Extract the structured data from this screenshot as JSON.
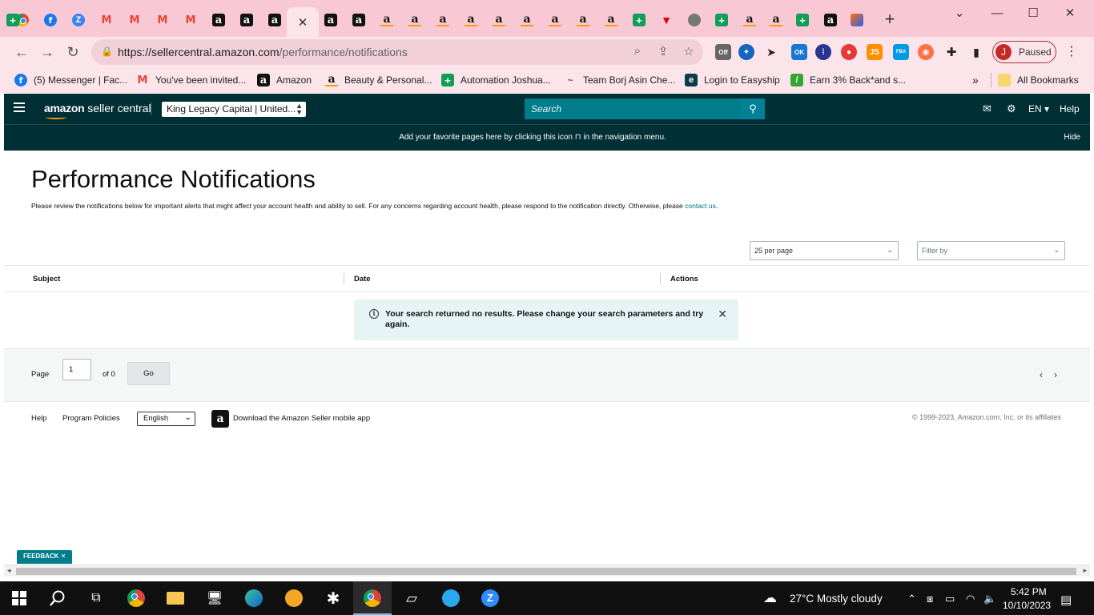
{
  "browser": {
    "tabs": [
      {
        "icon": "chrome-icon",
        "glyph": ""
      },
      {
        "icon": "facebook-icon",
        "glyph": "f"
      },
      {
        "icon": "zoho-icon",
        "glyph": "Z"
      },
      {
        "icon": "gmail-icon",
        "glyph": "M"
      },
      {
        "icon": "gmail-icon",
        "glyph": "M"
      },
      {
        "icon": "gmail-icon",
        "glyph": "M"
      },
      {
        "icon": "gmail-icon",
        "glyph": "M"
      },
      {
        "icon": "amazon-a-icon",
        "glyph": "a"
      },
      {
        "icon": "amazon-a-icon",
        "glyph": "a"
      },
      {
        "icon": "amazon-a-icon",
        "glyph": "a"
      },
      {
        "icon": "active-tab-close-icon",
        "glyph": "✕"
      },
      {
        "icon": "amazon-a-icon",
        "glyph": "a"
      },
      {
        "icon": "amazon-a-icon",
        "glyph": "a"
      },
      {
        "icon": "amazon-smile-icon",
        "glyph": "a"
      },
      {
        "icon": "amazon-smile-icon",
        "glyph": "a"
      },
      {
        "icon": "amazon-smile-icon",
        "glyph": "a"
      },
      {
        "icon": "amazon-smile-icon",
        "glyph": "a"
      },
      {
        "icon": "amazon-smile-icon",
        "glyph": "a"
      },
      {
        "icon": "amazon-smile-icon",
        "glyph": "a"
      },
      {
        "icon": "amazon-smile-icon",
        "glyph": "a"
      },
      {
        "icon": "amazon-smile-icon",
        "glyph": "a"
      },
      {
        "icon": "amazon-smile-icon",
        "glyph": "a"
      },
      {
        "icon": "google-sheets-icon",
        "glyph": "+"
      },
      {
        "icon": "red-triangle-icon",
        "glyph": "▼"
      },
      {
        "icon": "globe-icon",
        "glyph": ""
      },
      {
        "icon": "google-sheets-icon",
        "glyph": "+"
      },
      {
        "icon": "amazon-smile-icon",
        "glyph": "a"
      },
      {
        "icon": "amazon-smile-icon",
        "glyph": "a"
      },
      {
        "icon": "google-sheets-icon",
        "glyph": "+"
      },
      {
        "icon": "amazon-a-icon",
        "glyph": "a"
      },
      {
        "icon": "multicolor-app-icon",
        "glyph": ""
      },
      {
        "icon": "google-sheets-icon",
        "glyph": "+"
      }
    ],
    "new_tab": "+",
    "window_controls": {
      "chevron": "⌄",
      "minimize": "—",
      "maximize": "☐",
      "close": "✕"
    },
    "url_host": "https://sellercentral.amazon.com",
    "url_path": "/performance/notifications",
    "profile_initial": "J",
    "profile_status": "Paused",
    "extensions": {
      "off": "Off",
      "ok": "OK",
      "js": "JS",
      "fba": "FBA"
    }
  },
  "bookmarks": [
    {
      "label": "(5) Messenger | Fac...",
      "icon": "facebook-icon",
      "glyph": "f"
    },
    {
      "label": "You've been invited...",
      "icon": "gmail-icon",
      "glyph": "M"
    },
    {
      "label": "Amazon",
      "icon": "amazon-a-icon",
      "glyph": "a"
    },
    {
      "label": "Beauty & Personal...",
      "icon": "amazon-smile-icon",
      "glyph": "a"
    },
    {
      "label": "Automation Joshua...",
      "icon": "google-sheets-icon",
      "glyph": "+"
    },
    {
      "label": "Team Borj Asin Che...",
      "icon": "team-logo-icon",
      "glyph": "~"
    },
    {
      "label": "Login to Easyship",
      "icon": "easyship-icon",
      "glyph": "e"
    },
    {
      "label": "Earn 3% Back*and s...",
      "icon": "cashback-icon",
      "glyph": "/"
    }
  ],
  "bookmarks_more": "»",
  "all_bookmarks": "All Bookmarks",
  "seller_central": {
    "logo_amazon": "amazon",
    "logo_rest": " seller central",
    "account_selector": "King Legacy Capital | United...",
    "search_placeholder": "Search",
    "language": "EN",
    "help": "Help",
    "favorites_message": "Add your favorite pages here by clicking this icon",
    "favorites_message_tail": "in the navigation menu.",
    "hide": "Hide"
  },
  "page": {
    "title": "Performance Notifications",
    "intro": "Please review the notifications below for important alerts that might affect your account health and ability to sell. For any concerns regarding account health, please respond to the notification directly. Otherwise, please ",
    "contact_link": "contact us",
    "intro_end": ".",
    "per_page": "25 per page",
    "filter_placeholder": "Filter by",
    "columns": [
      "Subject",
      "Date",
      "Actions"
    ],
    "alert": "Your search returned no results. Please change your search parameters and try again.",
    "pager": {
      "page_label": "Page",
      "page_value": "1",
      "of_label": "of 0",
      "go": "Go"
    }
  },
  "footer": {
    "help": "Help",
    "program_policies": "Program Policies",
    "language": "English",
    "app_download": "Download the Amazon Seller mobile app",
    "copyright": "© 1999-2023, Amazon.com, Inc. or its affiliates"
  },
  "feedback": "FEEDBACK",
  "taskbar": {
    "weather": "27°C  Mostly cloudy",
    "time": "5:42 PM",
    "date": "10/10/2023"
  }
}
